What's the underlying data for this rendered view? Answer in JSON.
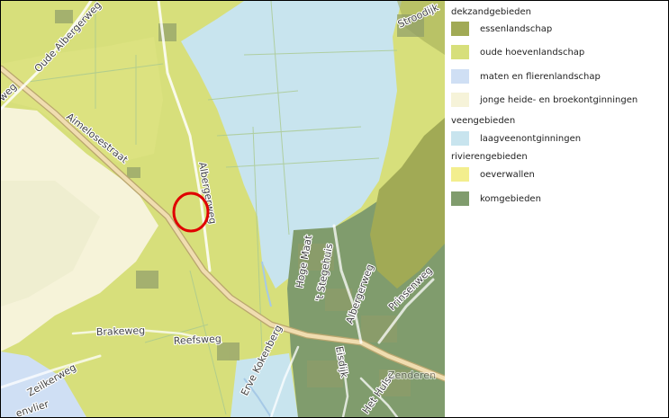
{
  "map": {
    "colors": {
      "essenlandschap": "#a1aa55",
      "oude_hoevenlandschap": "#d7df7b",
      "maten_en_flierenlandschap": "#cfdff4",
      "jonge_heide_broekontginningen": "#f6f3d9",
      "laagveenontginningen": "#c8e4ee",
      "oeverwallen": "#f3ee8e",
      "komgebieden": "#809c6d",
      "highlight_circle": "#e00000"
    },
    "roads": [
      {
        "name": "Oude Albergerweg"
      },
      {
        "name": "Aimelosestraat"
      },
      {
        "name": "Albergerweg"
      },
      {
        "name": "Hoge Maat"
      },
      {
        "name": "'t Stegehuis"
      },
      {
        "name": "Albergerweg"
      },
      {
        "name": "Prinsenweg"
      },
      {
        "name": "Brakeweg"
      },
      {
        "name": "Reefsweg"
      },
      {
        "name": "Erve Kokenberg"
      },
      {
        "name": "Eisdijk"
      },
      {
        "name": "Het Hulsc"
      },
      {
        "name": "Zeilkerweg"
      },
      {
        "name": "envlier"
      },
      {
        "name": "Stroodijk"
      },
      {
        "name": "Zenderen"
      },
      {
        "name": "weg"
      }
    ]
  },
  "legend": {
    "groups": [
      {
        "title": "dekzandgebieden",
        "items": [
          {
            "label": "essenlandschap",
            "color": "#a1aa55"
          },
          {
            "label": "oude hoevenlandschap",
            "color": "#d7df7b"
          },
          {
            "label": "maten en flierenlandschap",
            "color": "#cfdff4"
          },
          {
            "label": "jonge heide- en broekontginningen",
            "color": "#f6f3d9"
          }
        ]
      },
      {
        "title": "veengebieden",
        "items": [
          {
            "label": "laagveenontginningen",
            "color": "#c8e4ee"
          }
        ]
      },
      {
        "title": "rivierengebieden",
        "items": [
          {
            "label": "oeverwallen",
            "color": "#f3ee8e"
          },
          {
            "label": "komgebieden",
            "color": "#809c6d"
          }
        ]
      }
    ]
  }
}
